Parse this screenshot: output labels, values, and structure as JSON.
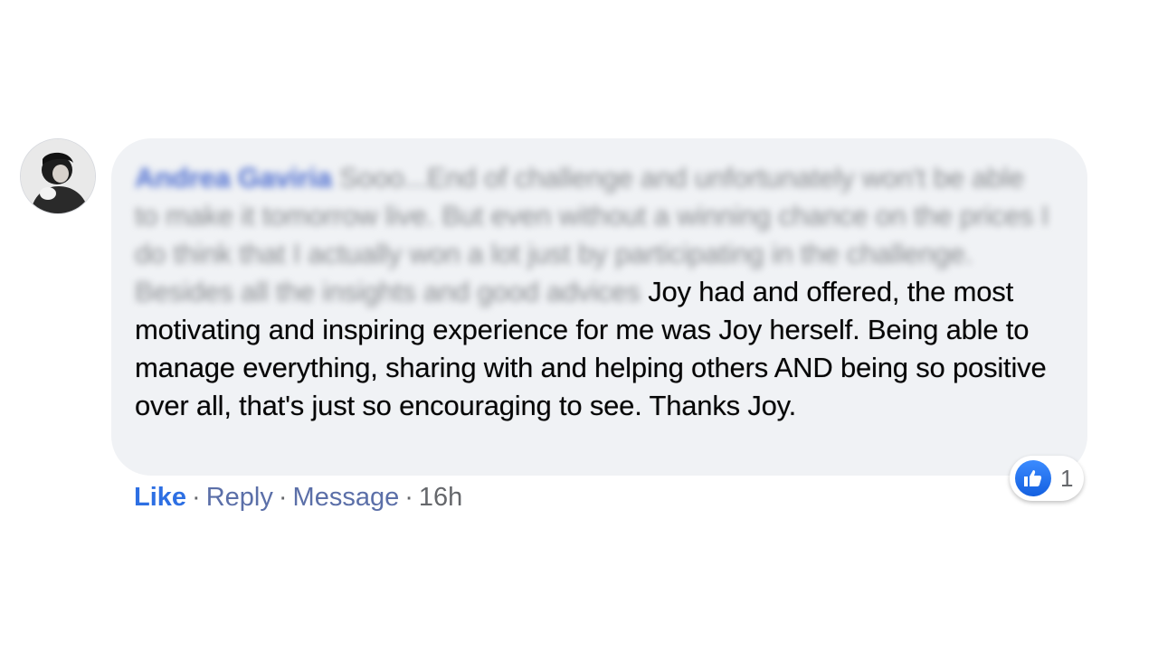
{
  "comment": {
    "author": "Andrea Gaviria",
    "blurred_text": "Sooo...End of challenge and unfortunately won't be able to make it tomorrow live. But even without a winning chance on the prices I do think that I actually won a lot just by participating in the challenge. Besides all the insights and good advices",
    "visible_text": "Joy had and offered, the most motivating and inspiring experience for me was Joy herself. Being able to manage everything, sharing with and helping others AND being so positive over all, that's just so encouraging to see. Thanks Joy."
  },
  "actions": {
    "like_label": "Like",
    "reply_label": "Reply",
    "message_label": "Message",
    "separator": "·",
    "timestamp": "16h"
  },
  "reactions": {
    "icon": "thumbs-up-icon",
    "count": "1",
    "color": "#1877f2"
  }
}
